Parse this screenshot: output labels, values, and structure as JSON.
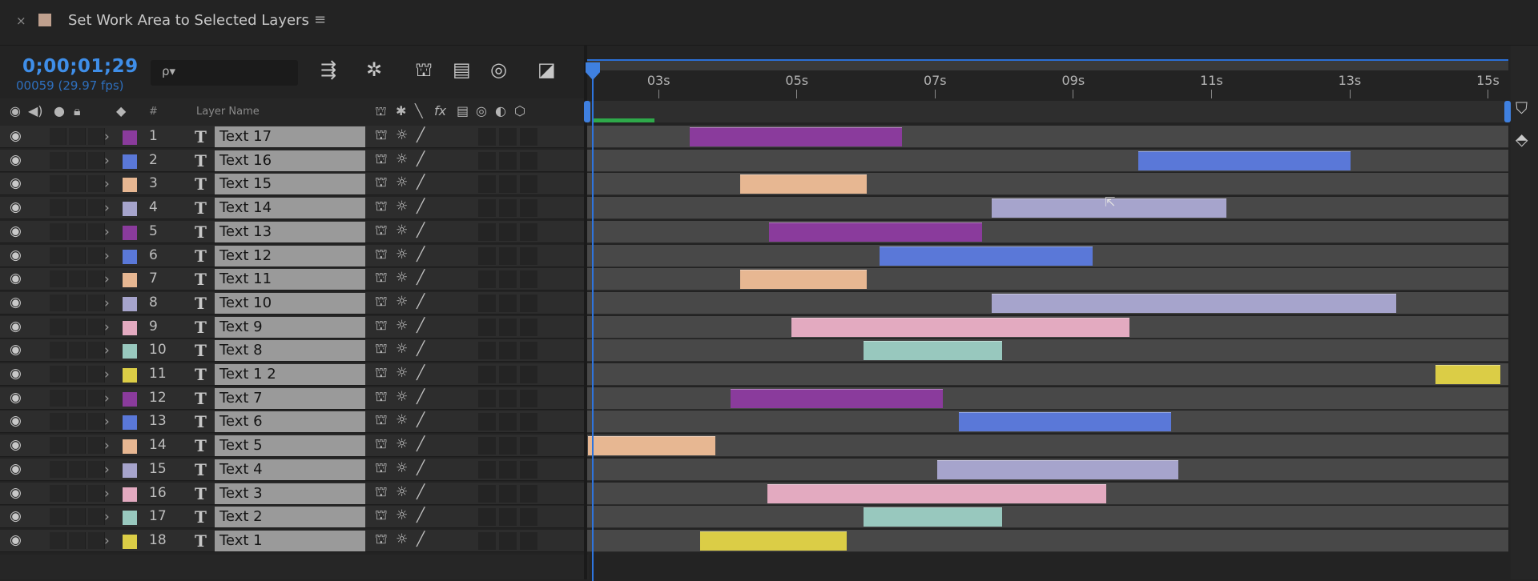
{
  "tab": {
    "close_label": "×",
    "title": "Set Work Area to Selected Layers",
    "menu_label": "≡",
    "swatch_color": "#bfa08e"
  },
  "toolbar": {
    "timecode": "0;00;01;29",
    "frame_info": "00059 (29.97 fps)",
    "search_icon": "ρ▾"
  },
  "columns": {
    "layer_name": "Layer Name",
    "hash": "#"
  },
  "ruler": {
    "labels": [
      "03s",
      "05s",
      "07s",
      "09s",
      "11s",
      "13s",
      "15s"
    ]
  },
  "label_colors": {
    "purple": "#8a3b9c",
    "blue": "#5a78d8",
    "peach": "#e7b792",
    "lavender": "#a6a4cc",
    "pink": "#e3aac0",
    "aqua": "#98c8be",
    "yellow": "#dbcd46"
  },
  "layers": [
    {
      "num": "1",
      "name": "Text 17",
      "color": "purple",
      "start": 3.45,
      "end": 6.52
    },
    {
      "num": "2",
      "name": "Text 16",
      "color": "blue",
      "start": 9.95,
      "end": 13.02
    },
    {
      "num": "3",
      "name": "Text 15",
      "color": "peach",
      "start": 4.18,
      "end": 6.02
    },
    {
      "num": "4",
      "name": "Text 14",
      "color": "lavender",
      "start": 7.82,
      "end": 11.22
    },
    {
      "num": "5",
      "name": "Text 13",
      "color": "purple",
      "start": 4.6,
      "end": 7.68
    },
    {
      "num": "6",
      "name": "Text 12",
      "color": "blue",
      "start": 6.2,
      "end": 9.28
    },
    {
      "num": "7",
      "name": "Text 11",
      "color": "peach",
      "start": 4.18,
      "end": 6.02
    },
    {
      "num": "8",
      "name": "Text 10",
      "color": "lavender",
      "start": 7.82,
      "end": 13.68
    },
    {
      "num": "9",
      "name": "Text 9",
      "color": "pink",
      "start": 4.92,
      "end": 9.82
    },
    {
      "num": "10",
      "name": "Text 8",
      "color": "aqua",
      "start": 5.97,
      "end": 7.97
    },
    {
      "num": "11",
      "name": "Text 1 2",
      "color": "yellow",
      "start": 14.25,
      "end": 15.18
    },
    {
      "num": "12",
      "name": "Text 7",
      "color": "purple",
      "start": 4.05,
      "end": 7.12
    },
    {
      "num": "13",
      "name": "Text 6",
      "color": "blue",
      "start": 7.35,
      "end": 10.42
    },
    {
      "num": "14",
      "name": "Text 5",
      "color": "peach",
      "start": 1.98,
      "end": 3.82
    },
    {
      "num": "15",
      "name": "Text 4",
      "color": "lavender",
      "start": 7.03,
      "end": 10.52
    },
    {
      "num": "16",
      "name": "Text 3",
      "color": "pink",
      "start": 4.58,
      "end": 9.48
    },
    {
      "num": "17",
      "name": "Text 2",
      "color": "aqua",
      "start": 5.97,
      "end": 7.97
    },
    {
      "num": "18",
      "name": "Text 1",
      "color": "yellow",
      "start": 3.6,
      "end": 5.72
    }
  ],
  "timeline": {
    "start_seconds": 1.97,
    "end_seconds": 15.3,
    "playhead_seconds": 1.97
  }
}
